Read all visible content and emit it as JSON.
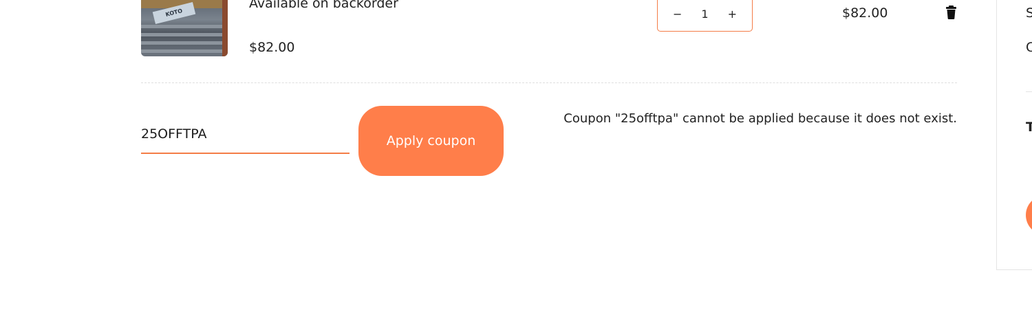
{
  "cart_item": {
    "stock_status": "Available on backorder",
    "price": "$82.00",
    "quantity": {
      "decrement": "−",
      "value": "1",
      "increment": "+"
    },
    "subtotal": "$82.00",
    "remove_icon": "trash-icon",
    "image_label": "KOTO"
  },
  "coupon": {
    "code_value": "25OFFTPA",
    "apply_label": "Apply coupon",
    "error_message": "Coupon \"25offtpa\" cannot be applied because it does not exist."
  },
  "summary_panel": {
    "row1_fragment": "S",
    "row2_fragment": "C",
    "total_fragment": "T"
  },
  "colors": {
    "accent": "#ff7e4a",
    "accent_border": "#f47c46"
  }
}
